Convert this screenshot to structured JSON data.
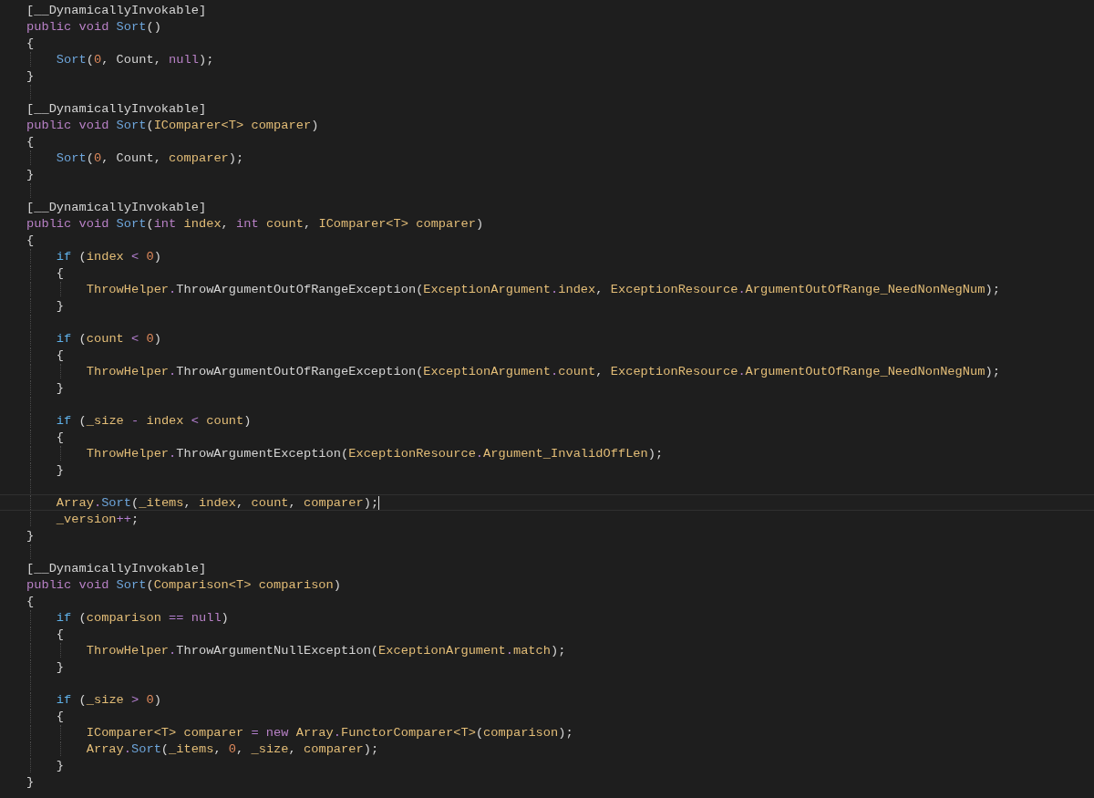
{
  "editor": {
    "lines": [
      {
        "kind": "code",
        "current": false,
        "tokens": [
          {
            "text": "[__DynamicallyInvokable]",
            "kind": "plain"
          }
        ]
      },
      {
        "kind": "code",
        "current": false,
        "tokens": [
          {
            "text": "public void ",
            "kind": "keyword"
          },
          {
            "text": "Sort",
            "kind": "method"
          },
          {
            "text": "()",
            "kind": "plain"
          }
        ]
      },
      {
        "kind": "code",
        "current": false,
        "tokens": [
          {
            "text": "{",
            "kind": "plain"
          }
        ]
      },
      {
        "kind": "code",
        "current": false,
        "tokens": [
          {
            "text": "    Sort",
            "kind": "method"
          },
          {
            "text": "(",
            "kind": "plain"
          },
          {
            "text": "0",
            "kind": "number"
          },
          {
            "text": ", Count, ",
            "kind": "plain"
          },
          {
            "text": "null",
            "kind": "keyword"
          },
          {
            "text": ");",
            "kind": "plain"
          }
        ]
      },
      {
        "kind": "code",
        "current": false,
        "tokens": [
          {
            "text": "}",
            "kind": "plain"
          }
        ]
      },
      {
        "kind": "blank"
      },
      {
        "kind": "code",
        "current": false,
        "tokens": [
          {
            "text": "[__DynamicallyInvokable]",
            "kind": "plain"
          }
        ]
      },
      {
        "kind": "code",
        "current": false,
        "tokens": [
          {
            "text": "public void ",
            "kind": "keyword"
          },
          {
            "text": "Sort",
            "kind": "method"
          },
          {
            "text": "(",
            "kind": "plain"
          },
          {
            "text": "IComparer<T> comparer",
            "kind": "ident"
          },
          {
            "text": ")",
            "kind": "plain"
          }
        ]
      },
      {
        "kind": "code",
        "current": false,
        "tokens": [
          {
            "text": "{",
            "kind": "plain"
          }
        ]
      },
      {
        "kind": "code",
        "current": false,
        "tokens": [
          {
            "text": "    Sort",
            "kind": "method"
          },
          {
            "text": "(",
            "kind": "plain"
          },
          {
            "text": "0",
            "kind": "number"
          },
          {
            "text": ", Count, ",
            "kind": "plain"
          },
          {
            "text": "comparer",
            "kind": "ident"
          },
          {
            "text": ");",
            "kind": "plain"
          }
        ]
      },
      {
        "kind": "code",
        "current": false,
        "tokens": [
          {
            "text": "}",
            "kind": "plain"
          }
        ]
      },
      {
        "kind": "blank"
      },
      {
        "kind": "code",
        "current": false,
        "tokens": [
          {
            "text": "[__DynamicallyInvokable]",
            "kind": "plain"
          }
        ]
      },
      {
        "kind": "code",
        "current": false,
        "tokens": [
          {
            "text": "public void ",
            "kind": "keyword"
          },
          {
            "text": "Sort",
            "kind": "method"
          },
          {
            "text": "(",
            "kind": "plain"
          },
          {
            "text": "int",
            "kind": "keyword"
          },
          {
            "text": " index",
            "kind": "ident"
          },
          {
            "text": ", ",
            "kind": "plain"
          },
          {
            "text": "int",
            "kind": "keyword"
          },
          {
            "text": " count",
            "kind": "ident"
          },
          {
            "text": ", ",
            "kind": "plain"
          },
          {
            "text": "IComparer<T> comparer",
            "kind": "ident"
          },
          {
            "text": ")",
            "kind": "plain"
          }
        ]
      },
      {
        "kind": "code",
        "current": false,
        "tokens": [
          {
            "text": "{",
            "kind": "plain"
          }
        ]
      },
      {
        "kind": "code",
        "current": false,
        "tokens": [
          {
            "text": "    if",
            "kind": "control"
          },
          {
            "text": " (",
            "kind": "plain"
          },
          {
            "text": "index",
            "kind": "ident"
          },
          {
            "text": " < ",
            "kind": "operator"
          },
          {
            "text": "0",
            "kind": "number"
          },
          {
            "text": ")",
            "kind": "plain"
          }
        ]
      },
      {
        "kind": "code",
        "current": false,
        "tokens": [
          {
            "text": "    {",
            "kind": "plain"
          }
        ]
      },
      {
        "kind": "code",
        "current": false,
        "tokens": [
          {
            "text": "        ThrowHelper",
            "kind": "ident"
          },
          {
            "text": ".",
            "kind": "operator"
          },
          {
            "text": "ThrowArgumentOutOfRangeException(",
            "kind": "plain"
          },
          {
            "text": "ExceptionArgument",
            "kind": "ident"
          },
          {
            "text": ".",
            "kind": "operator"
          },
          {
            "text": "index",
            "kind": "ident"
          },
          {
            "text": ", ",
            "kind": "plain"
          },
          {
            "text": "ExceptionResource",
            "kind": "ident"
          },
          {
            "text": ".",
            "kind": "operator"
          },
          {
            "text": "ArgumentOutOfRange_NeedNonNegNum",
            "kind": "ident"
          },
          {
            "text": ");",
            "kind": "plain"
          }
        ]
      },
      {
        "kind": "code",
        "current": false,
        "tokens": [
          {
            "text": "    }",
            "kind": "plain"
          }
        ]
      },
      {
        "kind": "blank"
      },
      {
        "kind": "code",
        "current": false,
        "tokens": [
          {
            "text": "    if",
            "kind": "control"
          },
          {
            "text": " (",
            "kind": "plain"
          },
          {
            "text": "count",
            "kind": "ident"
          },
          {
            "text": " < ",
            "kind": "operator"
          },
          {
            "text": "0",
            "kind": "number"
          },
          {
            "text": ")",
            "kind": "plain"
          }
        ]
      },
      {
        "kind": "code",
        "current": false,
        "tokens": [
          {
            "text": "    {",
            "kind": "plain"
          }
        ]
      },
      {
        "kind": "code",
        "current": false,
        "tokens": [
          {
            "text": "        ThrowHelper",
            "kind": "ident"
          },
          {
            "text": ".",
            "kind": "operator"
          },
          {
            "text": "ThrowArgumentOutOfRangeException(",
            "kind": "plain"
          },
          {
            "text": "ExceptionArgument",
            "kind": "ident"
          },
          {
            "text": ".",
            "kind": "operator"
          },
          {
            "text": "count",
            "kind": "ident"
          },
          {
            "text": ", ",
            "kind": "plain"
          },
          {
            "text": "ExceptionResource",
            "kind": "ident"
          },
          {
            "text": ".",
            "kind": "operator"
          },
          {
            "text": "ArgumentOutOfRange_NeedNonNegNum",
            "kind": "ident"
          },
          {
            "text": ");",
            "kind": "plain"
          }
        ]
      },
      {
        "kind": "code",
        "current": false,
        "tokens": [
          {
            "text": "    }",
            "kind": "plain"
          }
        ]
      },
      {
        "kind": "blank"
      },
      {
        "kind": "code",
        "current": false,
        "tokens": [
          {
            "text": "    if",
            "kind": "control"
          },
          {
            "text": " (",
            "kind": "plain"
          },
          {
            "text": "_size",
            "kind": "ident"
          },
          {
            "text": " - ",
            "kind": "operator"
          },
          {
            "text": "index",
            "kind": "ident"
          },
          {
            "text": " < ",
            "kind": "operator"
          },
          {
            "text": "count",
            "kind": "ident"
          },
          {
            "text": ")",
            "kind": "plain"
          }
        ]
      },
      {
        "kind": "code",
        "current": false,
        "tokens": [
          {
            "text": "    {",
            "kind": "plain"
          }
        ]
      },
      {
        "kind": "code",
        "current": false,
        "tokens": [
          {
            "text": "        ThrowHelper",
            "kind": "ident"
          },
          {
            "text": ".",
            "kind": "operator"
          },
          {
            "text": "ThrowArgumentException(",
            "kind": "plain"
          },
          {
            "text": "ExceptionResource",
            "kind": "ident"
          },
          {
            "text": ".",
            "kind": "operator"
          },
          {
            "text": "Argument_InvalidOffLen",
            "kind": "ident"
          },
          {
            "text": ");",
            "kind": "plain"
          }
        ]
      },
      {
        "kind": "code",
        "current": false,
        "tokens": [
          {
            "text": "    }",
            "kind": "plain"
          }
        ]
      },
      {
        "kind": "blank"
      },
      {
        "kind": "code",
        "current": true,
        "tokens": [
          {
            "text": "    Array",
            "kind": "ident"
          },
          {
            "text": ".",
            "kind": "operator"
          },
          {
            "text": "Sort",
            "kind": "method"
          },
          {
            "text": "(",
            "kind": "plain"
          },
          {
            "text": "_items",
            "kind": "ident"
          },
          {
            "text": ", ",
            "kind": "plain"
          },
          {
            "text": "index",
            "kind": "ident"
          },
          {
            "text": ", ",
            "kind": "plain"
          },
          {
            "text": "count",
            "kind": "ident"
          },
          {
            "text": ", ",
            "kind": "plain"
          },
          {
            "text": "comparer",
            "kind": "ident"
          },
          {
            "text": ");",
            "kind": "plain"
          }
        ]
      },
      {
        "kind": "code",
        "current": false,
        "tokens": [
          {
            "text": "    _version",
            "kind": "ident"
          },
          {
            "text": "++",
            "kind": "operator"
          },
          {
            "text": ";",
            "kind": "plain"
          }
        ]
      },
      {
        "kind": "code",
        "current": false,
        "tokens": [
          {
            "text": "}",
            "kind": "plain"
          }
        ]
      },
      {
        "kind": "blank"
      },
      {
        "kind": "code",
        "current": false,
        "tokens": [
          {
            "text": "[__DynamicallyInvokable]",
            "kind": "plain"
          }
        ]
      },
      {
        "kind": "code",
        "current": false,
        "tokens": [
          {
            "text": "public void ",
            "kind": "keyword"
          },
          {
            "text": "Sort",
            "kind": "method"
          },
          {
            "text": "(",
            "kind": "plain"
          },
          {
            "text": "Comparison<T> comparison",
            "kind": "ident"
          },
          {
            "text": ")",
            "kind": "plain"
          }
        ]
      },
      {
        "kind": "code",
        "current": false,
        "tokens": [
          {
            "text": "{",
            "kind": "plain"
          }
        ]
      },
      {
        "kind": "code",
        "current": false,
        "tokens": [
          {
            "text": "    if",
            "kind": "control"
          },
          {
            "text": " (",
            "kind": "plain"
          },
          {
            "text": "comparison",
            "kind": "ident"
          },
          {
            "text": " == ",
            "kind": "operator"
          },
          {
            "text": "null",
            "kind": "keyword"
          },
          {
            "text": ")",
            "kind": "plain"
          }
        ]
      },
      {
        "kind": "code",
        "current": false,
        "tokens": [
          {
            "text": "    {",
            "kind": "plain"
          }
        ]
      },
      {
        "kind": "code",
        "current": false,
        "tokens": [
          {
            "text": "        ThrowHelper",
            "kind": "ident"
          },
          {
            "text": ".",
            "kind": "operator"
          },
          {
            "text": "ThrowArgumentNullException(",
            "kind": "plain"
          },
          {
            "text": "ExceptionArgument",
            "kind": "ident"
          },
          {
            "text": ".",
            "kind": "operator"
          },
          {
            "text": "match",
            "kind": "ident"
          },
          {
            "text": ");",
            "kind": "plain"
          }
        ]
      },
      {
        "kind": "code",
        "current": false,
        "tokens": [
          {
            "text": "    }",
            "kind": "plain"
          }
        ]
      },
      {
        "kind": "blank"
      },
      {
        "kind": "code",
        "current": false,
        "tokens": [
          {
            "text": "    if",
            "kind": "control"
          },
          {
            "text": " (",
            "kind": "plain"
          },
          {
            "text": "_size",
            "kind": "ident"
          },
          {
            "text": " > ",
            "kind": "operator"
          },
          {
            "text": "0",
            "kind": "number"
          },
          {
            "text": ")",
            "kind": "plain"
          }
        ]
      },
      {
        "kind": "code",
        "current": false,
        "tokens": [
          {
            "text": "    {",
            "kind": "plain"
          }
        ]
      },
      {
        "kind": "code",
        "current": false,
        "tokens": [
          {
            "text": "        IComparer<T> comparer",
            "kind": "ident"
          },
          {
            "text": " = ",
            "kind": "operator"
          },
          {
            "text": "new",
            "kind": "keyword"
          },
          {
            "text": " Array",
            "kind": "ident"
          },
          {
            "text": ".",
            "kind": "operator"
          },
          {
            "text": "FunctorComparer<T>",
            "kind": "ident"
          },
          {
            "text": "(",
            "kind": "plain"
          },
          {
            "text": "comparison",
            "kind": "ident"
          },
          {
            "text": ");",
            "kind": "plain"
          }
        ]
      },
      {
        "kind": "code",
        "current": false,
        "tokens": [
          {
            "text": "        Array",
            "kind": "ident"
          },
          {
            "text": ".",
            "kind": "operator"
          },
          {
            "text": "Sort",
            "kind": "method"
          },
          {
            "text": "(",
            "kind": "plain"
          },
          {
            "text": "_items",
            "kind": "ident"
          },
          {
            "text": ", ",
            "kind": "plain"
          },
          {
            "text": "0",
            "kind": "number"
          },
          {
            "text": ", ",
            "kind": "plain"
          },
          {
            "text": "_size",
            "kind": "ident"
          },
          {
            "text": ", ",
            "kind": "plain"
          },
          {
            "text": "comparer",
            "kind": "ident"
          },
          {
            "text": ");",
            "kind": "plain"
          }
        ]
      },
      {
        "kind": "code",
        "current": false,
        "tokens": [
          {
            "text": "    }",
            "kind": "plain"
          }
        ]
      },
      {
        "kind": "code",
        "current": false,
        "tokens": [
          {
            "text": "}",
            "kind": "plain"
          }
        ]
      }
    ]
  }
}
